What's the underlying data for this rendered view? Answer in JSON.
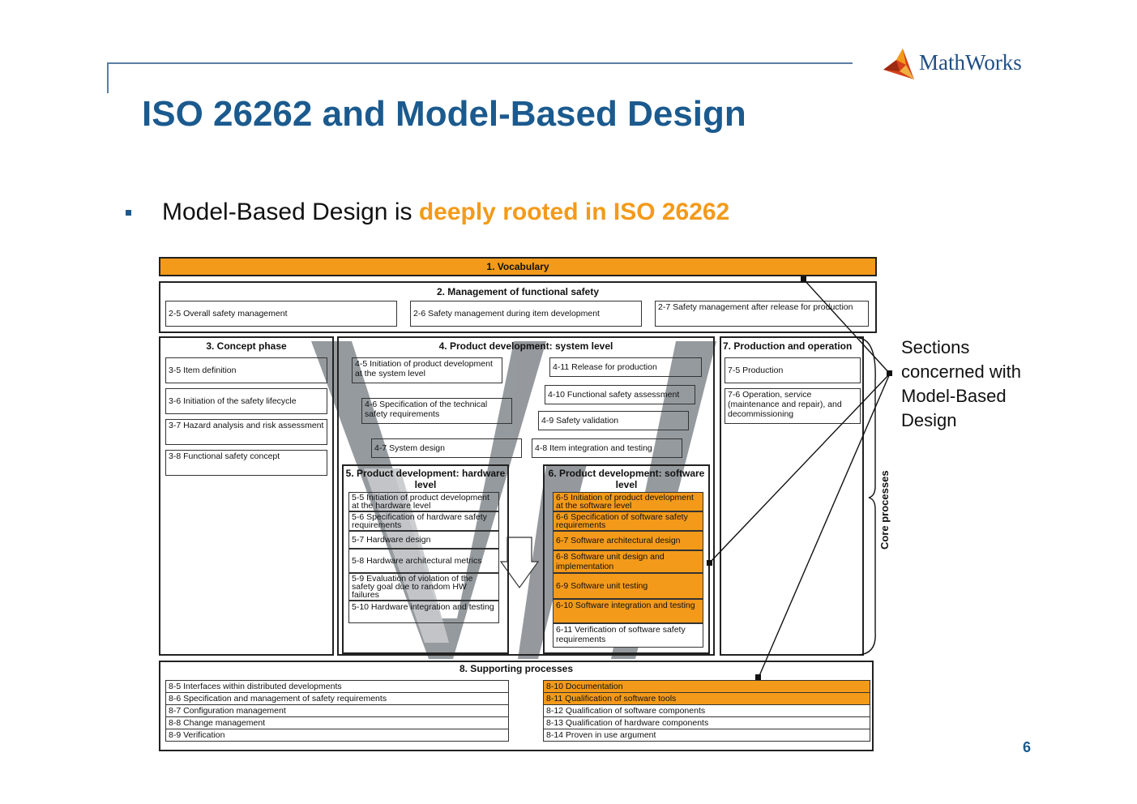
{
  "header": {
    "title": "ISO 26262 and Model-Based Design",
    "logo_text": "MathWorks",
    "logo_icon": "membrane-logo-icon"
  },
  "bullet": {
    "text_plain": "Model-Based Design is ",
    "text_highlight": "deeply rooted in ISO 26262"
  },
  "side_note": {
    "lines": [
      "Sections",
      "concerned with",
      "Model-Based",
      "Design"
    ]
  },
  "page_number": "6",
  "colors": {
    "accent": "#1b5a8e",
    "highlight": "#f39a1a",
    "v_shape": "#8a8f93"
  },
  "diagram": {
    "vocabulary": "1. Vocabulary",
    "management": {
      "title": "2. Management of functional safety",
      "items": [
        "2-5 Overall safety management",
        "2-6 Safety management during item development",
        "2-7 Safety management after release for production"
      ]
    },
    "concept": {
      "title": "3. Concept phase",
      "items": [
        "3-5 Item definition",
        "3-6 Initiation of the safety lifecycle",
        "3-7 Hazard analysis and risk assessment",
        "3-8 Functional safety concept"
      ]
    },
    "system": {
      "title": "4. Product development: system level",
      "items": [
        "4-5 Initiation of product development at the system level",
        "4-11 Release for production",
        "4-10 Functional safety assessment",
        "4-6 Specification of the technical safety requirements",
        "4-9 Safety validation",
        "4-7 System design",
        "4-8 Item integration and testing"
      ]
    },
    "production": {
      "title": "7. Production and operation",
      "items": [
        "7-5 Production",
        "7-6 Operation, service (maintenance and repair), and decommissioning"
      ]
    },
    "hardware": {
      "title": "5. Product development: hardware level",
      "items": [
        "5-5 Initiation of product development at the hardware level",
        "5-6 Specification of hardware safety requirements",
        "5-7 Hardware design",
        "5-8 Hardware architectural metrics",
        "5-9 Evaluation of violation of the safety goal due to random HW failures",
        "5-10 Hardware integration and testing"
      ]
    },
    "software": {
      "title": "6. Product development: software level",
      "items": [
        "6-5 Initiation of product development at the software level",
        "6-6 Specification of software safety requirements",
        "6-7 Software architectural design",
        "6-8 Software unit design and implementation",
        "6-9 Software unit testing",
        "6-10 Software integration and testing",
        "6-11 Verification of software safety requirements"
      ]
    },
    "core_processes": "Core processes",
    "supporting": {
      "title": "8. Supporting processes",
      "left": [
        "8-5 Interfaces within distributed developments",
        "8-6 Specification and management of safety requirements",
        "8-7 Configuration management",
        "8-8 Change management",
        "8-9 Verification"
      ],
      "right": [
        "8-10 Documentation",
        "8-11 Qualification of software tools",
        "8-12 Qualification of software components",
        "8-13 Qualification of hardware components",
        "8-14 Proven in use argument"
      ]
    }
  }
}
